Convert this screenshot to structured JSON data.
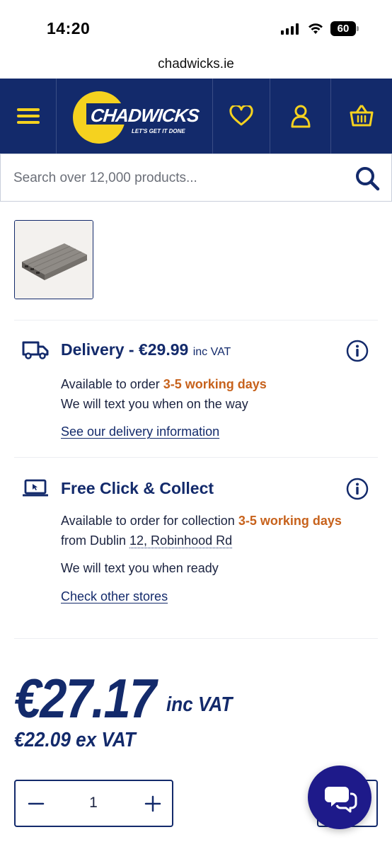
{
  "status_bar": {
    "time": "14:20",
    "battery": "60"
  },
  "browser": {
    "url": "chadwicks.ie"
  },
  "header": {
    "brand": "CHADWICKS",
    "tagline": "LET'S GET IT DONE",
    "icons": [
      "menu-icon",
      "heart-icon",
      "user-icon",
      "basket-icon"
    ],
    "bg_color": "#132a6b",
    "accent_color": "#f5d21f"
  },
  "search": {
    "placeholder": "Search over 12,000 products..."
  },
  "delivery": {
    "title": "Delivery - €29.99",
    "title_suffix": "inc VAT",
    "line1_prefix": "Available to order ",
    "line1_highlight": "3-5 working days",
    "line2": "We will text you when on the way",
    "link": "See our delivery information"
  },
  "click_collect": {
    "title": "Free Click & Collect",
    "line1_prefix": "Available to order for collection ",
    "line1_highlight": "3-5 working days",
    "line2_prefix": "from Dublin ",
    "line2_store": "12, Robinhood Rd",
    "line3": "We will text you when ready",
    "link": "Check other stores"
  },
  "price": {
    "inc_vat_value": "€27.17",
    "inc_vat_label": "inc VAT",
    "ex_vat_value": "€22.09",
    "ex_vat_label": "ex VAT"
  },
  "quantity": {
    "value": "1"
  },
  "colors": {
    "highlight": "#c7621c",
    "chat": "#1e1a8a"
  }
}
